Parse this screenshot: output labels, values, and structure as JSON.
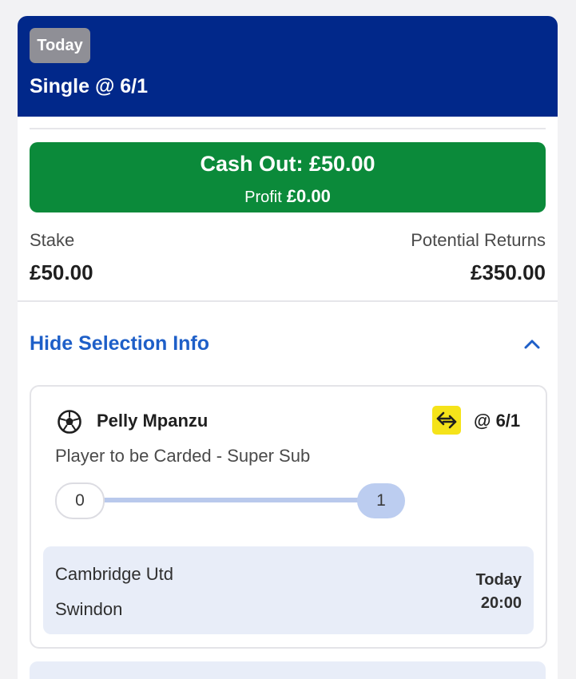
{
  "header": {
    "badge": "Today",
    "title": "Single @ 6/1",
    "background_color": "#01288a"
  },
  "cashout": {
    "label": "Cash Out: £50.00",
    "profit_label": "Profit",
    "profit_value": "£0.00",
    "color": "#0b8a3a"
  },
  "summary": {
    "stake_label": "Stake",
    "stake_value": "£50.00",
    "returns_label": "Potential Returns",
    "returns_value": "£350.00"
  },
  "selection_toggle": {
    "label": "Hide Selection Info",
    "icon": "chevron-up-icon",
    "color": "#1e5fc8"
  },
  "selection": {
    "sport_icon": "football-icon",
    "player": "Pelly Mpanzu",
    "boost_icon": "swap-icon",
    "odds": "@ 6/1",
    "market": "Player to be Carded - Super Sub",
    "progress": {
      "start": "0",
      "end": "1",
      "fraction": 1.0
    },
    "event": {
      "home": "Cambridge Utd",
      "away": "Swindon",
      "day": "Today",
      "time": "20:00"
    }
  }
}
